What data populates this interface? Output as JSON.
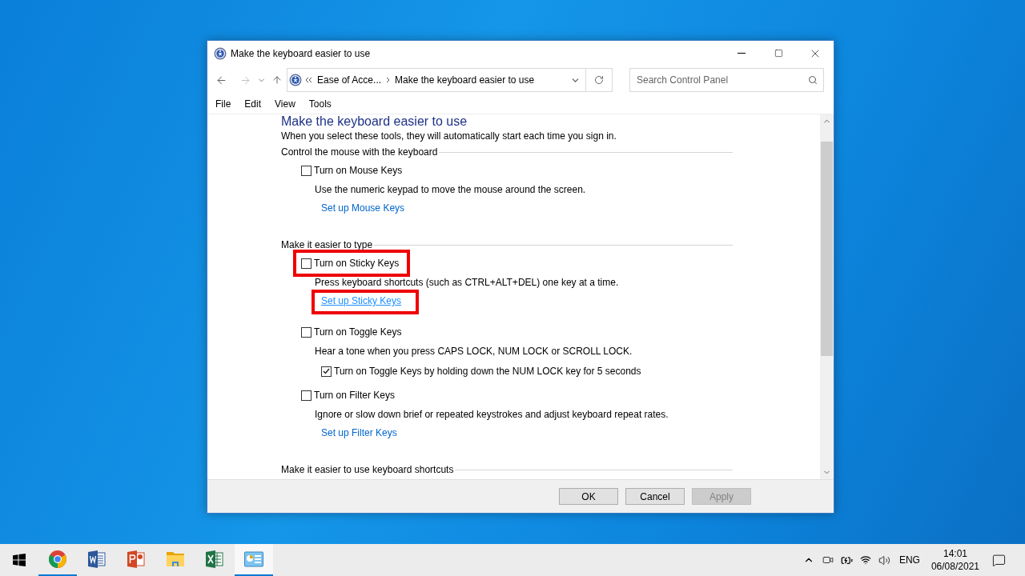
{
  "window": {
    "title": "Make the keyboard easier to use"
  },
  "nav": {
    "back_disabled": false,
    "forward_disabled": true,
    "breadcrumb": [
      "Ease of Acce...",
      "Make the keyboard easier to use"
    ],
    "search_placeholder": "Search Control Panel"
  },
  "menu": [
    "File",
    "Edit",
    "View",
    "Tools"
  ],
  "content": {
    "heading": "Make the keyboard easier to use",
    "intro": "When you select these tools, they will automatically start each time you sign in.",
    "sections": [
      {
        "title": "Control the mouse with the keyboard",
        "items": [
          {
            "kind": "checkbox",
            "label": "Turn on Mouse Keys",
            "checked": false,
            "highlighted": false
          },
          {
            "kind": "description",
            "text": "Use the numeric keypad to move the mouse around the screen."
          },
          {
            "kind": "link",
            "label": "Set up Mouse Keys",
            "highlighted": false
          }
        ]
      },
      {
        "title": "Make it easier to type",
        "items": [
          {
            "kind": "checkbox",
            "label": "Turn on Sticky Keys",
            "checked": false,
            "highlighted": true
          },
          {
            "kind": "description",
            "text": "Press keyboard shortcuts (such as CTRL+ALT+DEL) one key at a time."
          },
          {
            "kind": "link",
            "label": "Set up Sticky Keys",
            "highlighted": true
          },
          {
            "kind": "checkbox",
            "label": "Turn on Toggle Keys",
            "checked": false,
            "highlighted": false
          },
          {
            "kind": "description",
            "text": "Hear a tone when you press CAPS LOCK, NUM LOCK or SCROLL LOCK."
          },
          {
            "kind": "sub_checkbox",
            "label": "Turn on Toggle Keys by holding down the NUM LOCK key for 5 seconds",
            "checked": true,
            "highlighted": false
          },
          {
            "kind": "checkbox",
            "label": "Turn on Filter Keys",
            "checked": false,
            "highlighted": false
          },
          {
            "kind": "description",
            "text": "Ignore or slow down brief or repeated keystrokes and adjust keyboard repeat rates."
          },
          {
            "kind": "link",
            "label": "Set up Filter Keys",
            "highlighted": false
          }
        ]
      },
      {
        "title": "Make it easier to use keyboard shortcuts"
      }
    ]
  },
  "buttons": [
    {
      "label": "OK",
      "disabled": false
    },
    {
      "label": "Cancel",
      "disabled": false
    },
    {
      "label": "Apply",
      "disabled": true
    }
  ],
  "taskbar": {
    "apps": [
      {
        "kind": "browser",
        "running": true,
        "selected": false
      },
      {
        "kind": "word",
        "running": false,
        "selected": false
      },
      {
        "kind": "powerpoint",
        "running": false,
        "selected": false
      },
      {
        "kind": "explorer",
        "running": false,
        "selected": false
      },
      {
        "kind": "excel",
        "running": false,
        "selected": false
      },
      {
        "kind": "control_panel",
        "running": true,
        "selected": true
      }
    ],
    "language": "ENG",
    "time": "14:01",
    "date": "06/08/2021"
  }
}
